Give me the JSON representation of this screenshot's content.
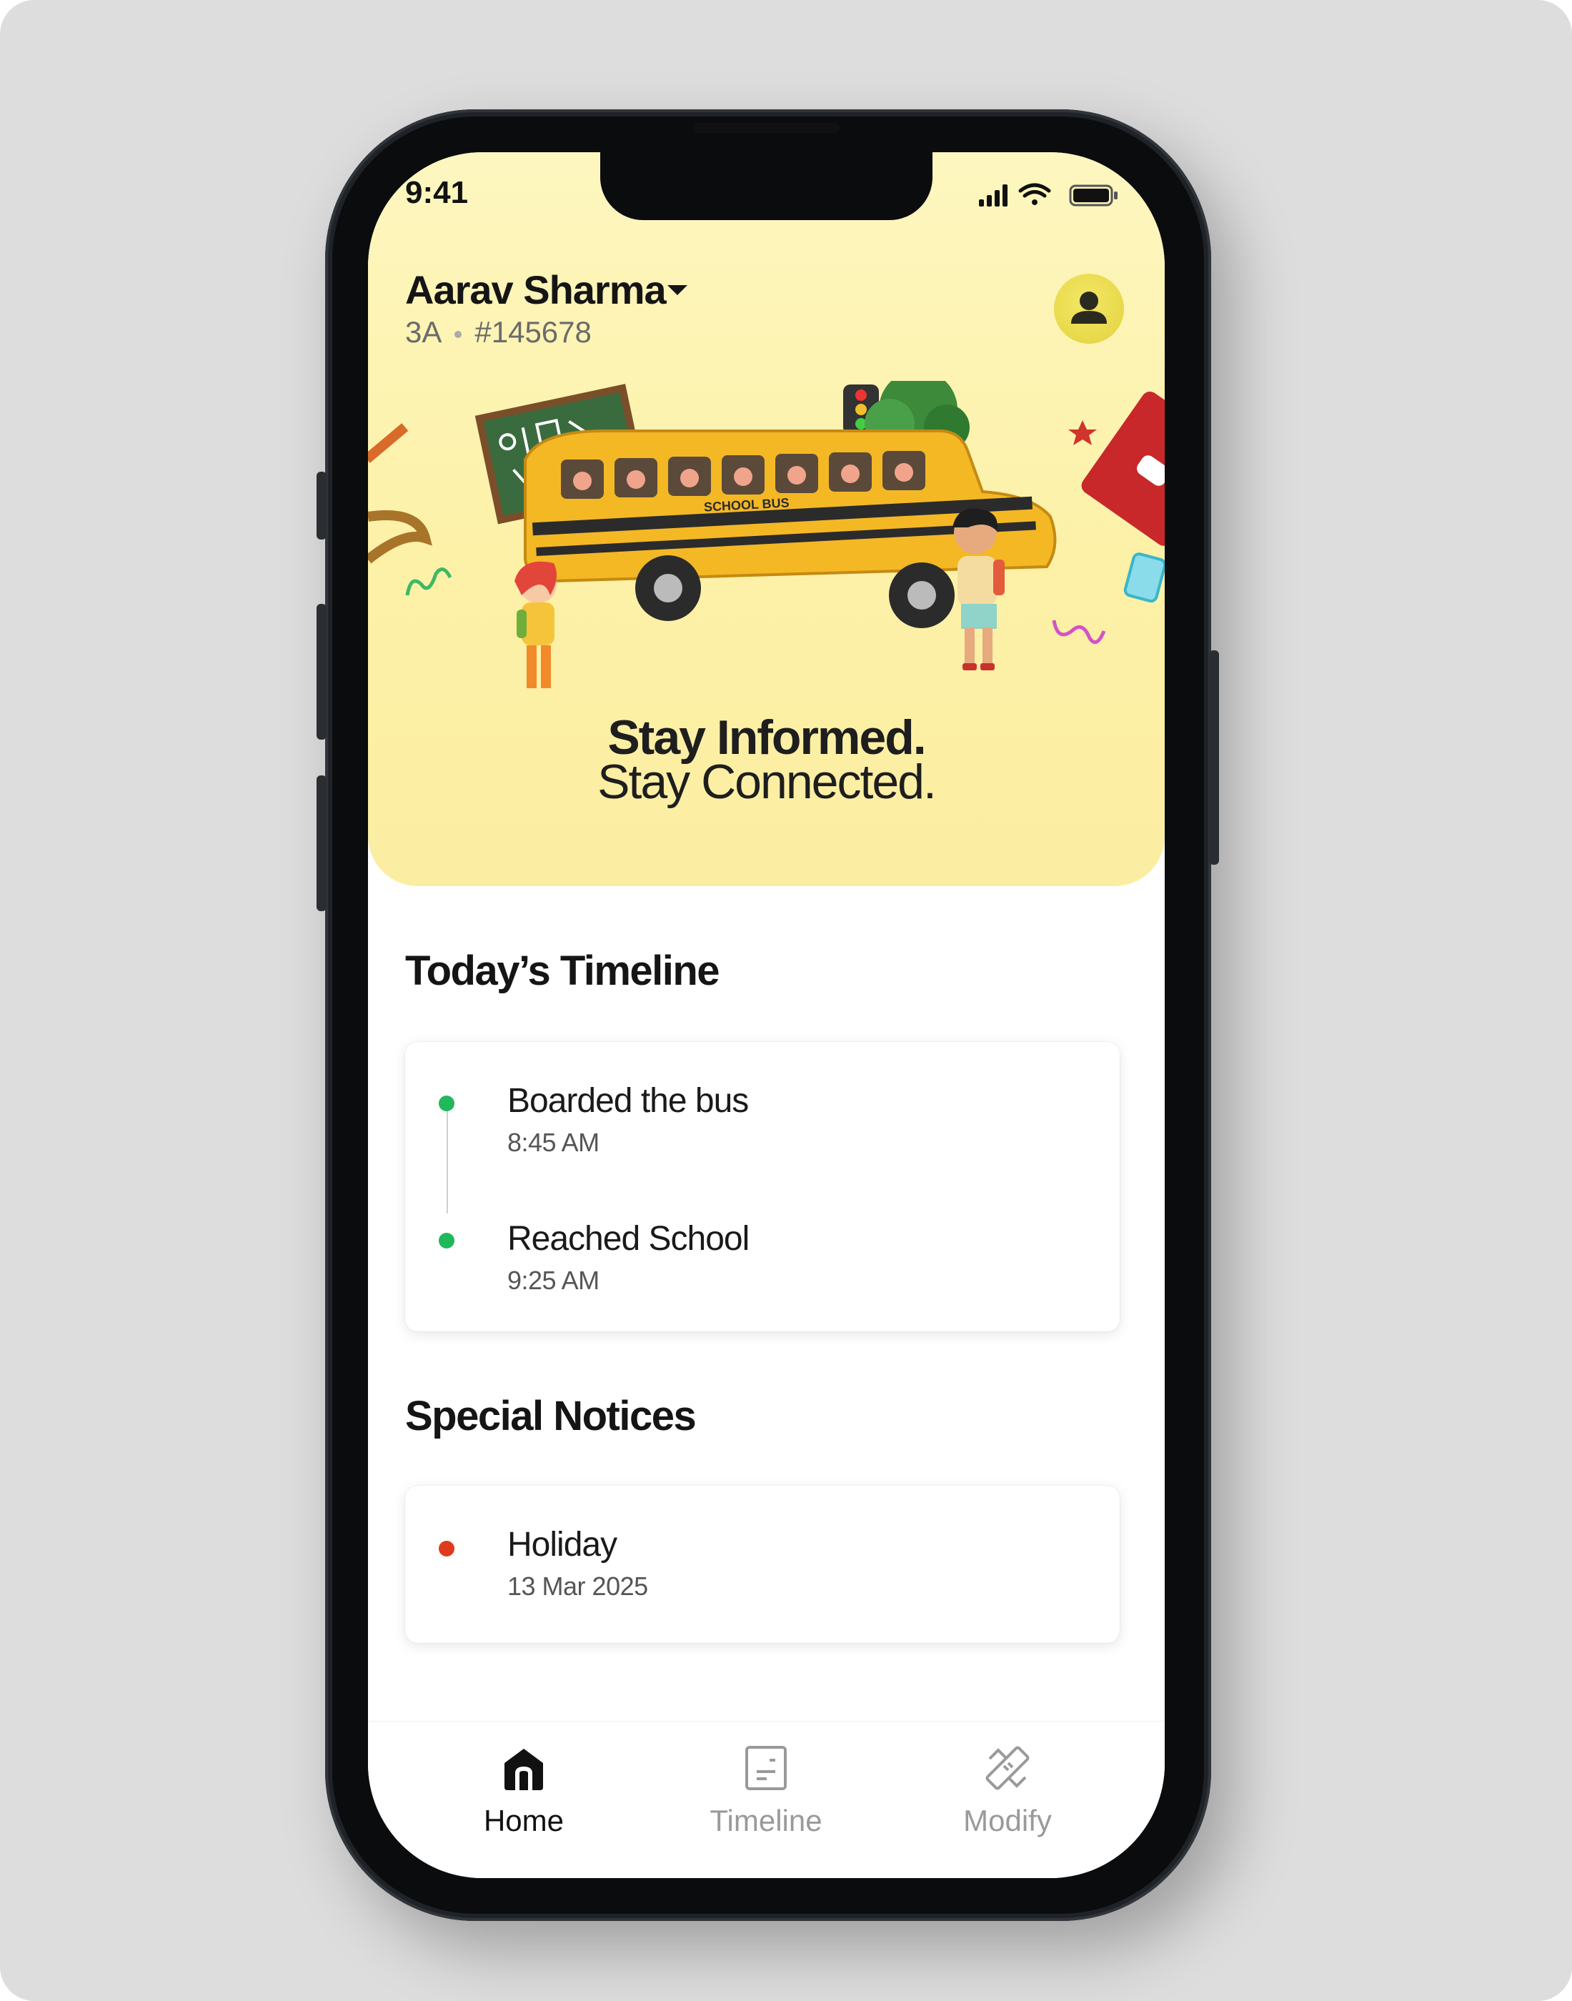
{
  "status_bar": {
    "time": "9:41"
  },
  "header": {
    "child_name": "Aarav Sharma",
    "class": "3A",
    "student_id": "#145678"
  },
  "hero": {
    "tagline_line1": "Stay Informed.",
    "tagline_line2": "Stay Connected.",
    "bus_label": "SCHOOL BUS"
  },
  "timeline": {
    "title": "Today’s Timeline",
    "items": [
      {
        "title": "Boarded the bus",
        "time": "8:45 AM",
        "status_color": "#1fb85a"
      },
      {
        "title": "Reached School",
        "time": "9:25 AM",
        "status_color": "#1fb85a"
      }
    ]
  },
  "notices": {
    "title": "Special Notices",
    "items": [
      {
        "title": "Holiday",
        "date": "13 Mar 2025",
        "status_color": "#e03a1e"
      }
    ]
  },
  "tabbar": {
    "tabs": [
      {
        "label": "Home",
        "icon": "home-icon",
        "active": true
      },
      {
        "label": "Timeline",
        "icon": "timeline-icon",
        "active": false
      },
      {
        "label": "Modify",
        "icon": "modify-icon",
        "active": false
      }
    ]
  }
}
